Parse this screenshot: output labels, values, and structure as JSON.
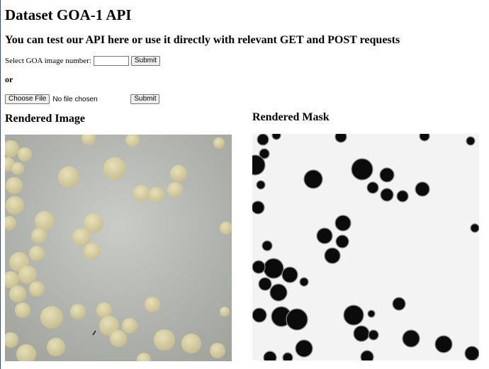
{
  "header": {
    "title": "Dataset GOA-1 API",
    "subtitle": "You can test our API here or use it directly with relevant GET and POST requests"
  },
  "select_form": {
    "label": "Select GOA image number:",
    "value": "",
    "submit_label": "Submit"
  },
  "separator": "or",
  "upload_form": {
    "choose_label": "Choose File",
    "status": "No file chosen",
    "submit_label": "Submit"
  },
  "sections": {
    "image_label": "Rendered Image",
    "mask_label": "Rendered Mask"
  },
  "colors": {
    "image_background": "#b9bcb6",
    "grain": "#d8cfa0",
    "mask_background": "#f4f4f4",
    "mask_blob": "#0a0a0a"
  }
}
